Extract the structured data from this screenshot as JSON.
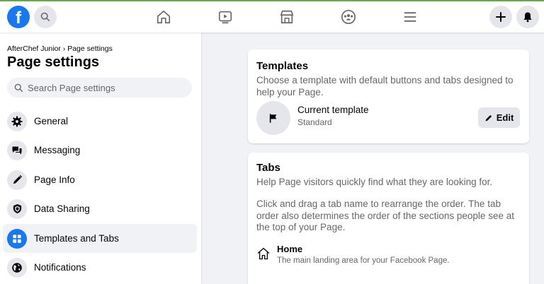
{
  "colors": {
    "accent_line": "#6aa84f",
    "brand": "#1877f2"
  },
  "topbar": {
    "logo_letter": "f",
    "icons": {
      "search": "search-icon",
      "home": "home-icon",
      "watch": "watch-icon",
      "marketplace": "marketplace-icon",
      "groups": "groups-icon",
      "menu": "menu-icon",
      "create": "plus-icon",
      "notifications": "bell-icon"
    }
  },
  "sidebar": {
    "breadcrumb": "AfterChef Junior › Page settings",
    "title": "Page settings",
    "search_placeholder": "Search Page settings",
    "items": [
      {
        "label": "General",
        "icon": "gear-icon"
      },
      {
        "label": "Messaging",
        "icon": "messaging-icon"
      },
      {
        "label": "Page Info",
        "icon": "pencil-icon"
      },
      {
        "label": "Data Sharing",
        "icon": "shield-icon"
      },
      {
        "label": "Templates and Tabs",
        "icon": "grid-icon",
        "active": true
      },
      {
        "label": "Notifications",
        "icon": "globe-icon"
      }
    ]
  },
  "templates_card": {
    "title": "Templates",
    "description": "Choose a template with default buttons and tabs designed to help your Page.",
    "current_label": "Current template",
    "current_value": "Standard",
    "edit_label": "Edit"
  },
  "tabs_card": {
    "title": "Tabs",
    "description": "Help Page visitors quickly find what they are looking for.",
    "instructions": "Click and drag a tab name to rearrange the order. The tab order also determines the order of the sections people see at the top of your Page.",
    "tabs": [
      {
        "name": "Home",
        "description": "The main landing area for your Facebook Page."
      }
    ]
  }
}
